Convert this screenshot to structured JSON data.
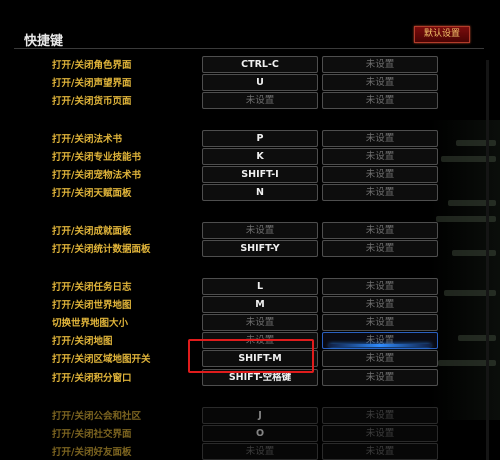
{
  "panel": {
    "title": "快捷键",
    "default_button": "默认设置"
  },
  "unset_text": "未设置",
  "rows": [
    {
      "label": "打开/关闭角色界面",
      "key1": "CTRL-C",
      "key2": "未设置"
    },
    {
      "label": "打开/关闭声望界面",
      "key1": "U",
      "key2": "未设置"
    },
    {
      "label": "打开/关闭货币页面",
      "key1": "未设置",
      "key2": "未设置"
    },
    {
      "label": "打开/关闭法术书",
      "key1": "P",
      "key2": "未设置"
    },
    {
      "label": "打开/关闭专业技能书",
      "key1": "K",
      "key2": "未设置"
    },
    {
      "label": "打开/关闭宠物法术书",
      "key1": "SHIFT-I",
      "key2": "未设置"
    },
    {
      "label": "打开/关闭天赋面板",
      "key1": "N",
      "key2": "未设置"
    },
    {
      "label": "打开/关闭成就面板",
      "key1": "未设置",
      "key2": "未设置"
    },
    {
      "label": "打开/关闭统计数据面板",
      "key1": "SHIFT-Y",
      "key2": "未设置"
    },
    {
      "label": "打开/关闭任务日志",
      "key1": "L",
      "key2": "未设置"
    },
    {
      "label": "打开/关闭世界地图",
      "key1": "M",
      "key2": "未设置"
    },
    {
      "label": "切换世界地图大小",
      "key1": "未设置",
      "key2": "未设置"
    },
    {
      "label": "打开/关闭地图",
      "key1": "未设置",
      "key2": "未设置"
    },
    {
      "label": "打开/关闭区域地图开关",
      "key1": "SHIFT-M",
      "key2": "未设置"
    },
    {
      "label": "打开/关闭积分窗口",
      "key1": "SHIFT-空格键",
      "key2": "未设置"
    },
    {
      "label": "打开/关闭公会和社区",
      "key1": "J",
      "key2": "未设置"
    },
    {
      "label": "打开/关闭社交界面",
      "key1": "O",
      "key2": "未设置"
    },
    {
      "label": "打开/关闭好友面板",
      "key1": "未设置",
      "key2": "未设置"
    }
  ],
  "colors": {
    "label": "#e0b43a",
    "set_key": "#f0f0f0",
    "unset_key": "#6e6e6e",
    "highlight_box": "#e01c1c",
    "selection_bar": "#2f8cff"
  }
}
